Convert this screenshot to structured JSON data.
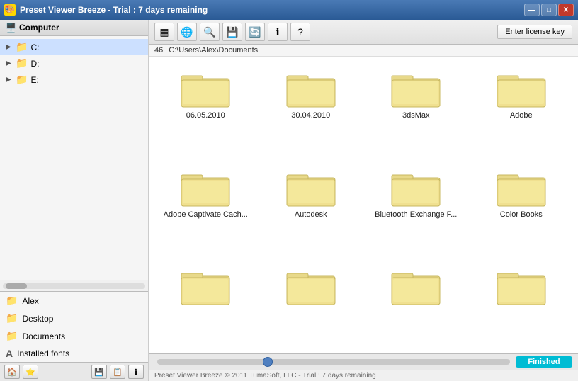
{
  "titlebar": {
    "title": "Preset Viewer Breeze - Trial : 7 days remaining",
    "win_min": "—",
    "win_max": "□",
    "win_close": "✕"
  },
  "left_panel": {
    "header": "Computer",
    "tree_items": [
      {
        "label": "C:",
        "selected": true
      },
      {
        "label": "D:",
        "selected": false
      },
      {
        "label": "E:",
        "selected": false
      }
    ],
    "bottom_items": [
      {
        "label": "Alex",
        "icon": "📁"
      },
      {
        "label": "Desktop",
        "icon": "📁"
      },
      {
        "label": "Documents",
        "icon": "📁"
      },
      {
        "label": "Installed fonts",
        "icon": "A"
      }
    ]
  },
  "toolbar": {
    "icons": [
      "▦",
      "🌐",
      "🔍",
      "💾",
      "🔄",
      "ℹ",
      "?"
    ],
    "license_btn": "Enter license key",
    "file_count": "46",
    "path": "C:\\Users\\Alex\\Documents"
  },
  "files": [
    {
      "name": "06.05.2010"
    },
    {
      "name": "30.04.2010"
    },
    {
      "name": "3dsMax"
    },
    {
      "name": "Adobe"
    },
    {
      "name": "Adobe Captivate Cach..."
    },
    {
      "name": "Autodesk"
    },
    {
      "name": "Bluetooth Exchange F..."
    },
    {
      "name": "Color Books"
    },
    {
      "name": ""
    },
    {
      "name": ""
    },
    {
      "name": ""
    },
    {
      "name": ""
    }
  ],
  "bottom": {
    "slider_label": "",
    "status": "Finished"
  },
  "footer": {
    "text": "Preset Viewer Breeze © 2011 TumaSoft, LLC - Trial : 7 days remaining"
  }
}
